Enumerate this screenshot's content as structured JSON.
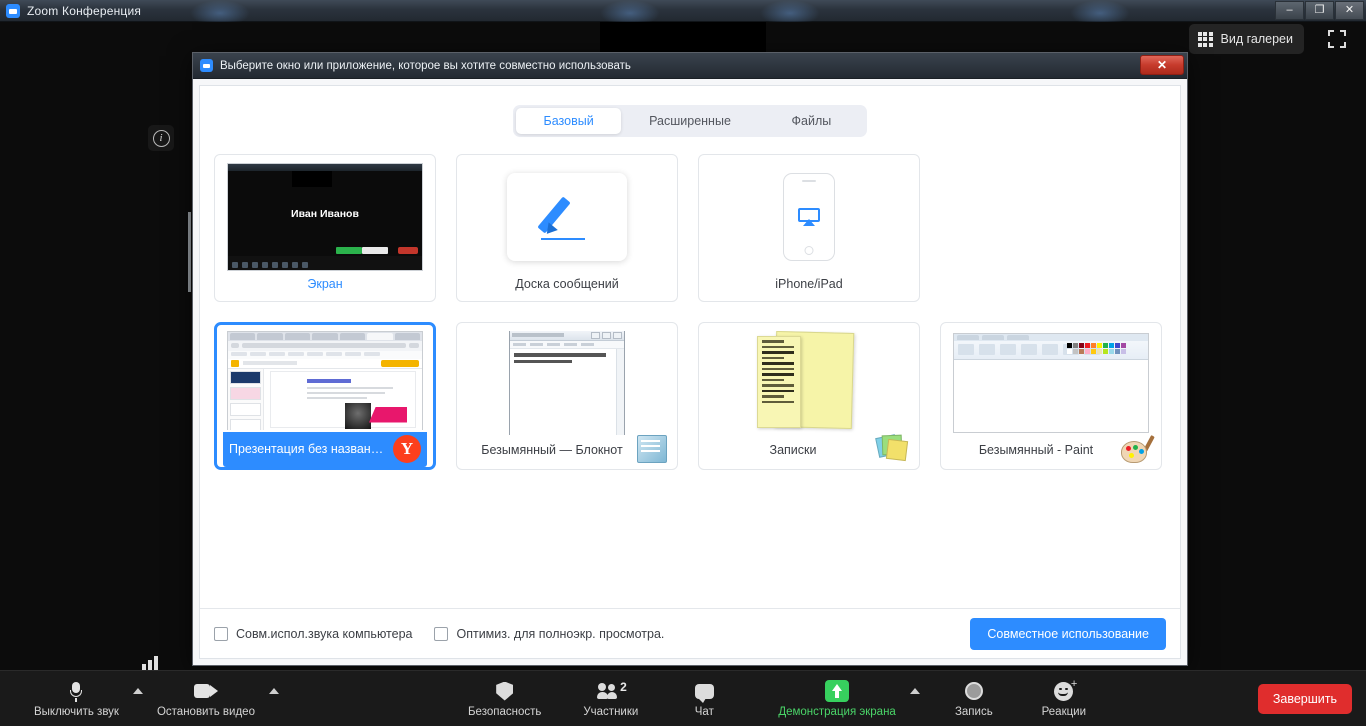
{
  "os_window": {
    "title": "Zoom Конференция",
    "minimize": "–",
    "restore": "❐",
    "close": "✕"
  },
  "meeting": {
    "gallery_view_label": "Вид галереи",
    "gallery_icon": "grid-icon",
    "fullscreen_icon": "fullscreen-icon",
    "info_icon": "info-icon",
    "signal_icon": "signal-strength-icon"
  },
  "dialog": {
    "title": "Выберите окно или приложение, которое вы хотите совместно использовать",
    "close_label": "✕",
    "tabs": [
      {
        "label": "Базовый",
        "active": true
      },
      {
        "label": "Расширенные",
        "active": false
      },
      {
        "label": "Файлы",
        "active": false
      }
    ],
    "cards": [
      {
        "caption": "Экран",
        "kind": "screen",
        "selected": false,
        "highlight": true,
        "thumb_name": "Иван Иванов"
      },
      {
        "caption": "Доска сообщений",
        "kind": "whiteboard",
        "selected": false,
        "highlight": false
      },
      {
        "caption": "iPhone/iPad",
        "kind": "phone",
        "selected": false,
        "highlight": false
      },
      {
        "caption": "Презентация без названия - Go...",
        "kind": "presentation",
        "selected": true,
        "highlight": false,
        "badge": "Y"
      },
      {
        "caption": "Безымянный — Блокнот",
        "kind": "notepad",
        "selected": false,
        "highlight": false
      },
      {
        "caption": "Записки",
        "kind": "sticky",
        "selected": false,
        "highlight": false
      },
      {
        "caption": "Безымянный - Paint",
        "kind": "paint",
        "selected": false,
        "highlight": false
      }
    ],
    "footer": {
      "checkbox_audio": "Совм.испол.звука компьютера",
      "checkbox_optimize": "Оптимиз. для полноэкр. просмотра.",
      "share_button": "Совместное использование"
    }
  },
  "toolbar": {
    "mute": "Выключить звук",
    "video": "Остановить видео",
    "security": "Безопасность",
    "participants": "Участники",
    "participants_count": "2",
    "chat": "Чат",
    "share_screen": "Демонстрация экрана",
    "record": "Запись",
    "reactions": "Реакции",
    "end": "Завершить"
  },
  "colors": {
    "accent_blue": "#2d8cff",
    "share_green": "#37d05e",
    "end_red": "#e02d2d",
    "yandex_red": "#fc3f1d"
  }
}
